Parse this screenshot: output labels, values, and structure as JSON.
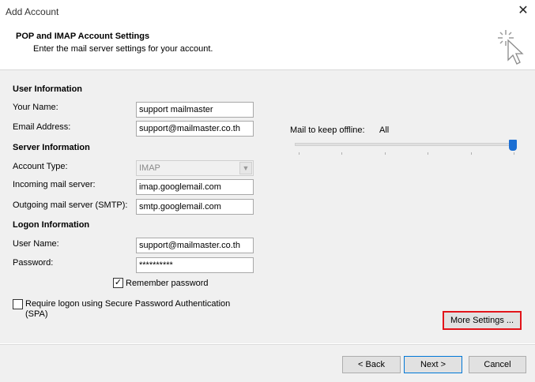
{
  "window": {
    "title": "Add Account"
  },
  "header": {
    "title": "POP and IMAP Account Settings",
    "subtitle": "Enter the mail server settings for your account."
  },
  "user_information": {
    "heading": "User Information",
    "name_label": "Your Name:",
    "name_value": "support mailmaster",
    "email_label": "Email Address:",
    "email_value": "support@mailmaster.co.th"
  },
  "server_information": {
    "heading": "Server Information",
    "account_type_label": "Account Type:",
    "account_type_value": "IMAP",
    "incoming_label": "Incoming mail server:",
    "incoming_value": "imap.googlemail.com",
    "outgoing_label": "Outgoing mail server (SMTP):",
    "outgoing_value": "smtp.googlemail.com"
  },
  "logon_information": {
    "heading": "Logon Information",
    "username_label": "User Name:",
    "username_value": "support@mailmaster.co.th",
    "password_label": "Password:",
    "password_value": "**********",
    "remember_label": "Remember password",
    "remember_checked": true,
    "spa_label_line1": "Require logon using Secure Password Authentication",
    "spa_label_line2": "(SPA)",
    "spa_checked": false
  },
  "offline": {
    "label": "Mail to keep offline:",
    "value": "All",
    "level_percent": 100
  },
  "buttons": {
    "more_settings": "More Settings ...",
    "back": "< Back",
    "next": "Next >",
    "cancel": "Cancel"
  },
  "icons": {
    "close": "close-icon",
    "wand": "wand-cursor-icon",
    "dropdown": "chevron-down-icon",
    "check": "checkmark-icon"
  },
  "colors": {
    "highlight": "#e2141a",
    "slider_thumb": "#1c6fd3"
  }
}
